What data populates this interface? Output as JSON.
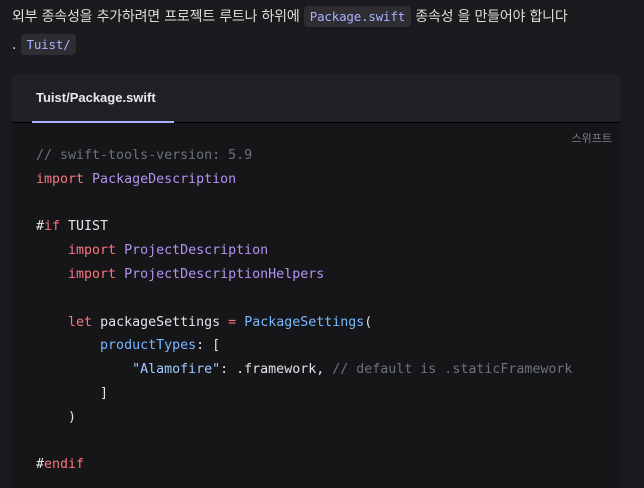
{
  "intro": {
    "text_before": "외부 종속성을 추가하려면 프로젝트 루트나 하위에 ",
    "code_file": "Package.swift",
    "text_after": " 종속성 을 만들어야 합니다",
    "prefix_dot": ". ",
    "code_dir": "Tuist/"
  },
  "code_block": {
    "tab_label": "Tuist/Package.swift",
    "language": "스위프트",
    "lines": {
      "l1": {
        "comment": "// swift-tools-version: 5.9"
      },
      "l2": {
        "kw": "import",
        "name": " PackageDescription"
      },
      "l4": {
        "hash": "#",
        "kw": "if",
        "name": " TUIST"
      },
      "l5": {
        "indent": "    ",
        "kw": "import",
        "name": " ProjectDescription"
      },
      "l6": {
        "indent": "    ",
        "kw": "import",
        "name": " ProjectDescriptionHelpers"
      },
      "l8": {
        "indent": "    ",
        "kw": "let",
        "var": " packageSettings ",
        "op": "=",
        "sp": " ",
        "type": "PackageSettings",
        "paren": "("
      },
      "l9": {
        "indent": "        ",
        "param": "productTypes",
        "rest": ": ["
      },
      "l10": {
        "indent": "            ",
        "str": "\"Alamofire\"",
        "colon": ": ",
        "value": ".framework, ",
        "comment": "// default is .staticFramework"
      },
      "l11": {
        "indent": "        ",
        "text": "]"
      },
      "l12": {
        "indent": "    ",
        "text": ")"
      },
      "l14": {
        "hash": "#",
        "kw": "endif"
      }
    }
  }
}
